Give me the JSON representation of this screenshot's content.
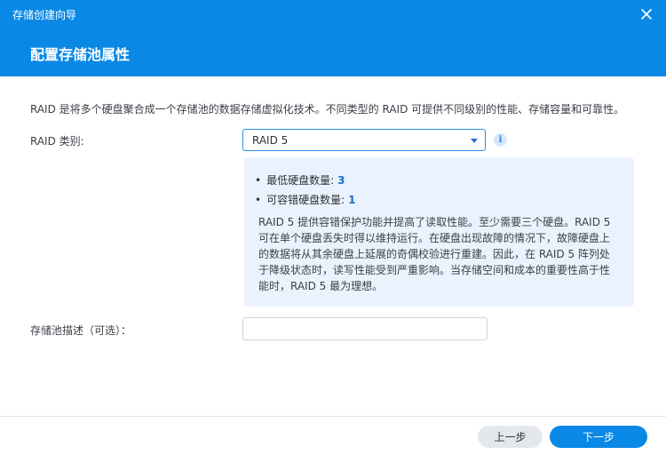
{
  "window": {
    "title": "存储创建向导"
  },
  "header": {
    "title": "配置存储池属性"
  },
  "intro": "RAID 是将多个硬盘聚合成一个存储池的数据存储虚拟化技术。不同类型的 RAID 可提供不同级别的性能、存储容量和可靠性。",
  "raid": {
    "label": "RAID 类别:",
    "selected": "RAID 5"
  },
  "info_panel": {
    "min_disks_label": "最低硬盘数量:",
    "min_disks_value": "3",
    "tolerance_label": "可容错硬盘数量:",
    "tolerance_value": "1",
    "description": "RAID 5 提供容错保护功能并提高了读取性能。至少需要三个硬盘。RAID 5 可在单个硬盘丢失时得以维持运行。在硬盘出现故障的情况下，故障硬盘上的数据将从其余硬盘上延展的奇偶校验进行重建。因此，在 RAID 5 阵列处于降级状态时，读写性能受到严重影响。当存储空间和成本的重要性高于性能时，RAID 5 最为理想。"
  },
  "pool_description": {
    "label": "存储池描述（可选）：",
    "value": ""
  },
  "footer": {
    "prev_label": "上一步",
    "next_label": "下一步"
  },
  "colors": {
    "header_bg": "#0a88e6",
    "primary_button": "#0a88e6",
    "info_panel_bg": "#eaf3fd",
    "value_highlight": "#1a6fc8"
  },
  "icons": {
    "close": "close-icon",
    "dropdown": "chevron-down-icon",
    "info": "info-icon"
  }
}
